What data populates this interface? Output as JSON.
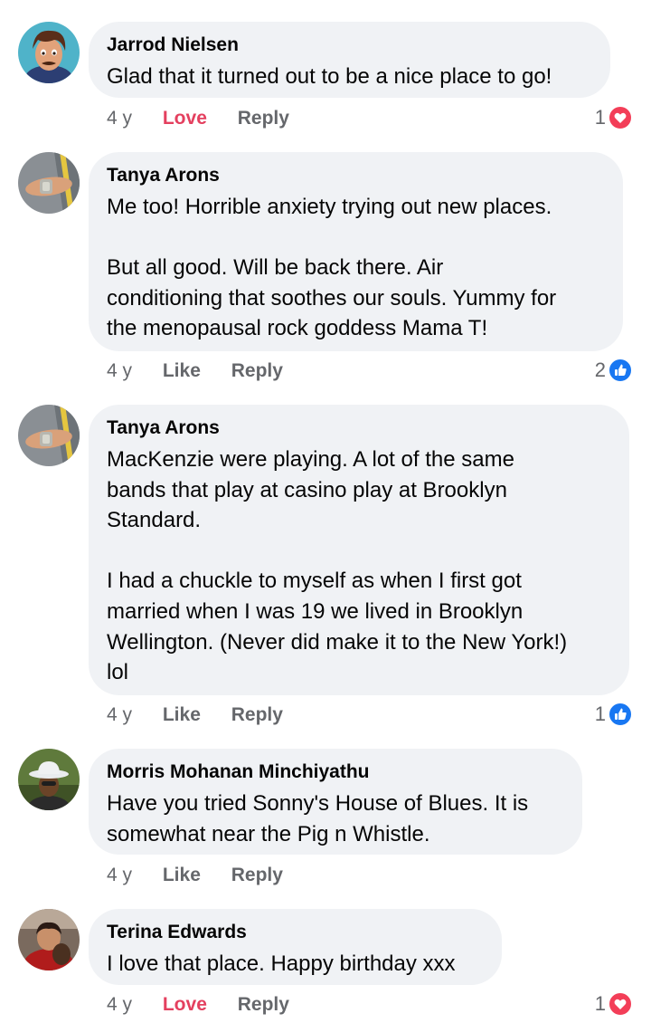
{
  "comments": [
    {
      "name": "Jarrod Nielsen",
      "text": "Glad that it turned out to be a nice place to go!",
      "time": "4 y",
      "reaction_label": "Love",
      "reply_label": "Reply",
      "reaction_count": "1",
      "reaction_icon": "heart-icon",
      "avatar": "cartoon-avatar"
    },
    {
      "name": "Tanya Arons",
      "text": "Me too!  Horrible anxiety trying out new places.\n\nBut all good.  Will be back there.  Air\nconditioning that soothes our souls.  Yummy for\nthe menopausal rock goddess Mama T!",
      "time": "4 y",
      "reaction_label": "Like",
      "reply_label": "Reply",
      "reaction_count": "2",
      "reaction_icon": "thumbs-up-icon",
      "avatar": "wrist-photo-avatar"
    },
    {
      "name": "Tanya Arons",
      "text": "MacKenzie were playing.  A lot of the same\nbands that play at casino play at Brooklyn\nStandard.\n\nI had a chuckle to myself as when I first got\nmarried when I was 19 we lived in Brooklyn\nWellington.  (Never did make it to the New York!)\nlol",
      "time": "4 y",
      "reaction_label": "Like",
      "reply_label": "Reply",
      "reaction_count": "1",
      "reaction_icon": "thumbs-up-icon",
      "avatar": "wrist-photo-avatar"
    },
    {
      "name": "Morris Mohanan Minchiyathu",
      "text": "Have you tried Sonny's House of  Blues. It is\nsomewhat near the Pig n Whistle.",
      "time": "4 y",
      "reaction_label": "Like",
      "reply_label": "Reply",
      "avatar": "man-with-hat-avatar"
    },
    {
      "name": "Terina Edwards",
      "text": "I love that place. Happy birthday xxx",
      "time": "4 y",
      "reaction_label": "Love",
      "reply_label": "Reply",
      "reaction_count": "1",
      "reaction_icon": "heart-icon",
      "avatar": "person-photo-avatar"
    }
  ],
  "colors": {
    "bubble": "#f0f2f5",
    "meta_text": "#65676b",
    "love_red": "#e4405f",
    "like_blue": "#1877f2"
  }
}
